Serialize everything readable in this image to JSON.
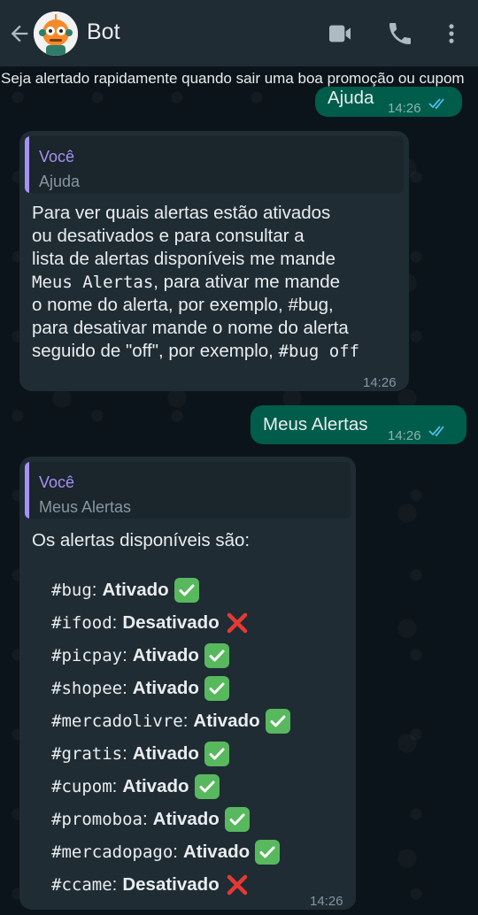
{
  "header": {
    "title": "Bot",
    "back_icon": "arrow-left-icon",
    "video_icon": "video-camera-icon",
    "call_icon": "phone-icon",
    "menu_icon": "more-vertical-icon"
  },
  "banner": {
    "text": "Seja alertado rapidamente quando sair uma boa promoção ou cupom"
  },
  "messages": [
    {
      "direction": "out",
      "text": "Ajuda",
      "time": "14:26",
      "status": "read"
    },
    {
      "direction": "in",
      "quote_author": "Você",
      "quote_text": "Ajuda",
      "lines": [
        "Para ver quais alertas estão ativados",
        "ou desativados e para consultar a",
        "lista de alertas disponíveis me mande",
        "Meus Alertas, para ativar me mande",
        "o nome do alerta, por exemplo, #bug,",
        "para desativar mande o nome do alerta",
        "seguido de \"off\", por exemplo, #bug off"
      ],
      "time": "14:26"
    },
    {
      "direction": "out",
      "text": "Meus Alertas",
      "time": "14:26",
      "status": "read"
    },
    {
      "direction": "in",
      "quote_author": "Você",
      "quote_text": "Meus Alertas",
      "intro": "Os alertas disponíveis são:",
      "alerts": [
        {
          "tag": "#bug",
          "status": "Ativado",
          "enabled": true
        },
        {
          "tag": "#ifood",
          "status": "Desativado",
          "enabled": false
        },
        {
          "tag": "#picpay",
          "status": "Ativado",
          "enabled": true
        },
        {
          "tag": "#shopee",
          "status": "Ativado",
          "enabled": true
        },
        {
          "tag": "#mercadolivre",
          "status": "Ativado",
          "enabled": true
        },
        {
          "tag": "#gratis",
          "status": "Ativado",
          "enabled": true
        },
        {
          "tag": "#cupom",
          "status": "Ativado",
          "enabled": true
        },
        {
          "tag": "#promoboa",
          "status": "Ativado",
          "enabled": true
        },
        {
          "tag": "#mercadopago",
          "status": "Ativado",
          "enabled": true
        },
        {
          "tag": "#ccame",
          "status": "Desativado",
          "enabled": false
        }
      ],
      "time": "14:26"
    }
  ],
  "colors": {
    "header_bg": "#1f2c34",
    "chat_bg": "#0b141a",
    "outgoing_bubble": "#005c4b",
    "incoming_bubble": "#1f2c34",
    "quote_accent": "#a791f3",
    "read_ticks": "#53bdeb",
    "check_green": "#58b85e",
    "cross_red": "#e53935"
  }
}
